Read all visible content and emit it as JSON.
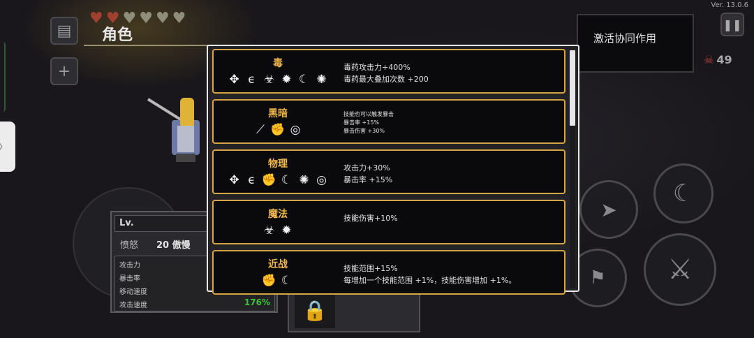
{
  "version": "Ver. 13.0.6",
  "header": {
    "title": "角色",
    "hearts": [
      "full",
      "full",
      "empty",
      "empty",
      "empty",
      "empty"
    ]
  },
  "combo": {
    "label": "激活协同作用"
  },
  "kills": {
    "count": "49"
  },
  "stats": {
    "level_label": "Lv.",
    "rage_label": "愤怒",
    "rage_value": "20 傲慢",
    "rows": [
      {
        "label": "攻击力",
        "value": ""
      },
      {
        "label": "暴击率",
        "value": ""
      },
      {
        "label": "移动速度",
        "value": ""
      },
      {
        "label": "攻击速度",
        "value": "176%"
      }
    ]
  },
  "synergies": [
    {
      "name": "毒",
      "icons": [
        "thorn-vine-icon",
        "whip-icon",
        "biohazard-icon",
        "burst-icon",
        "crescent-slash-icon",
        "spider-icon"
      ],
      "desc": [
        "毒药攻击力+400%",
        "毒药最大叠加次数 +200"
      ],
      "small": false
    },
    {
      "name": "黑暗",
      "icons": [
        "dark-spear-icon",
        "fist-icon",
        "vortex-icon"
      ],
      "desc": [
        "技能也可以触发暴击",
        "暴击率 +15%",
        "暴击伤害 +30%"
      ],
      "small": true
    },
    {
      "name": "物理",
      "icons": [
        "thorn-vine-icon",
        "whip-icon",
        "fist-icon",
        "crescent-slash-icon",
        "spider-icon",
        "vortex-icon"
      ],
      "desc": [
        "攻击力+30%",
        "暴击率 +15%"
      ],
      "small": false
    },
    {
      "name": "魔法",
      "icons": [
        "biohazard-icon",
        "burst-icon"
      ],
      "desc": [
        "技能伤害+10%"
      ],
      "small": false
    },
    {
      "name": "近战",
      "icons": [
        "fist-icon",
        "crescent-slash-icon"
      ],
      "desc": [
        "技能范围+15%",
        "每增加一个技能范围 +1%，技能伤害增加 +1%。"
      ],
      "small": false
    }
  ],
  "colors": {
    "card_border": "#d7a448",
    "card_title": "#f0b84a",
    "stat_green": "#38c838"
  }
}
